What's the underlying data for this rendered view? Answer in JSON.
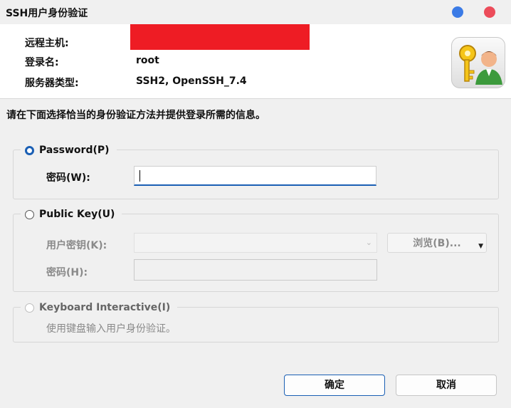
{
  "window": {
    "title": "SSH用户身份验证"
  },
  "header": {
    "remote_host_label": "远程主机:",
    "login_name_label": "登录名:",
    "login_name_value": "root",
    "server_type_label": "服务器类型:",
    "server_type_value": "SSH2, OpenSSH_7.4"
  },
  "instruction": "请在下面选择恰当的身份验证方法并提供登录所需的信息。",
  "password_group": {
    "legend": "Password(P)",
    "selected": true,
    "field_label": "密码(W):",
    "value": ""
  },
  "publickey_group": {
    "legend": "Public Key(U)",
    "selected": false,
    "key_label": "用户密钥(K):",
    "browse_label": "浏览(B)...",
    "passphrase_label": "密码(H):"
  },
  "keyboard_group": {
    "legend": "Keyboard Interactive(I)",
    "selected": false,
    "description": "使用键盘输入用户身份验证。"
  },
  "buttons": {
    "ok": "确定",
    "cancel": "取消"
  },
  "colors": {
    "accent": "#1a5fb4",
    "redaction": "#ee1c24",
    "minimize": "#3b7be6",
    "close": "#ec4c5a"
  },
  "icons": [
    "key-user-icon",
    "chevron-down-icon",
    "dropdown-arrow-icon"
  ]
}
